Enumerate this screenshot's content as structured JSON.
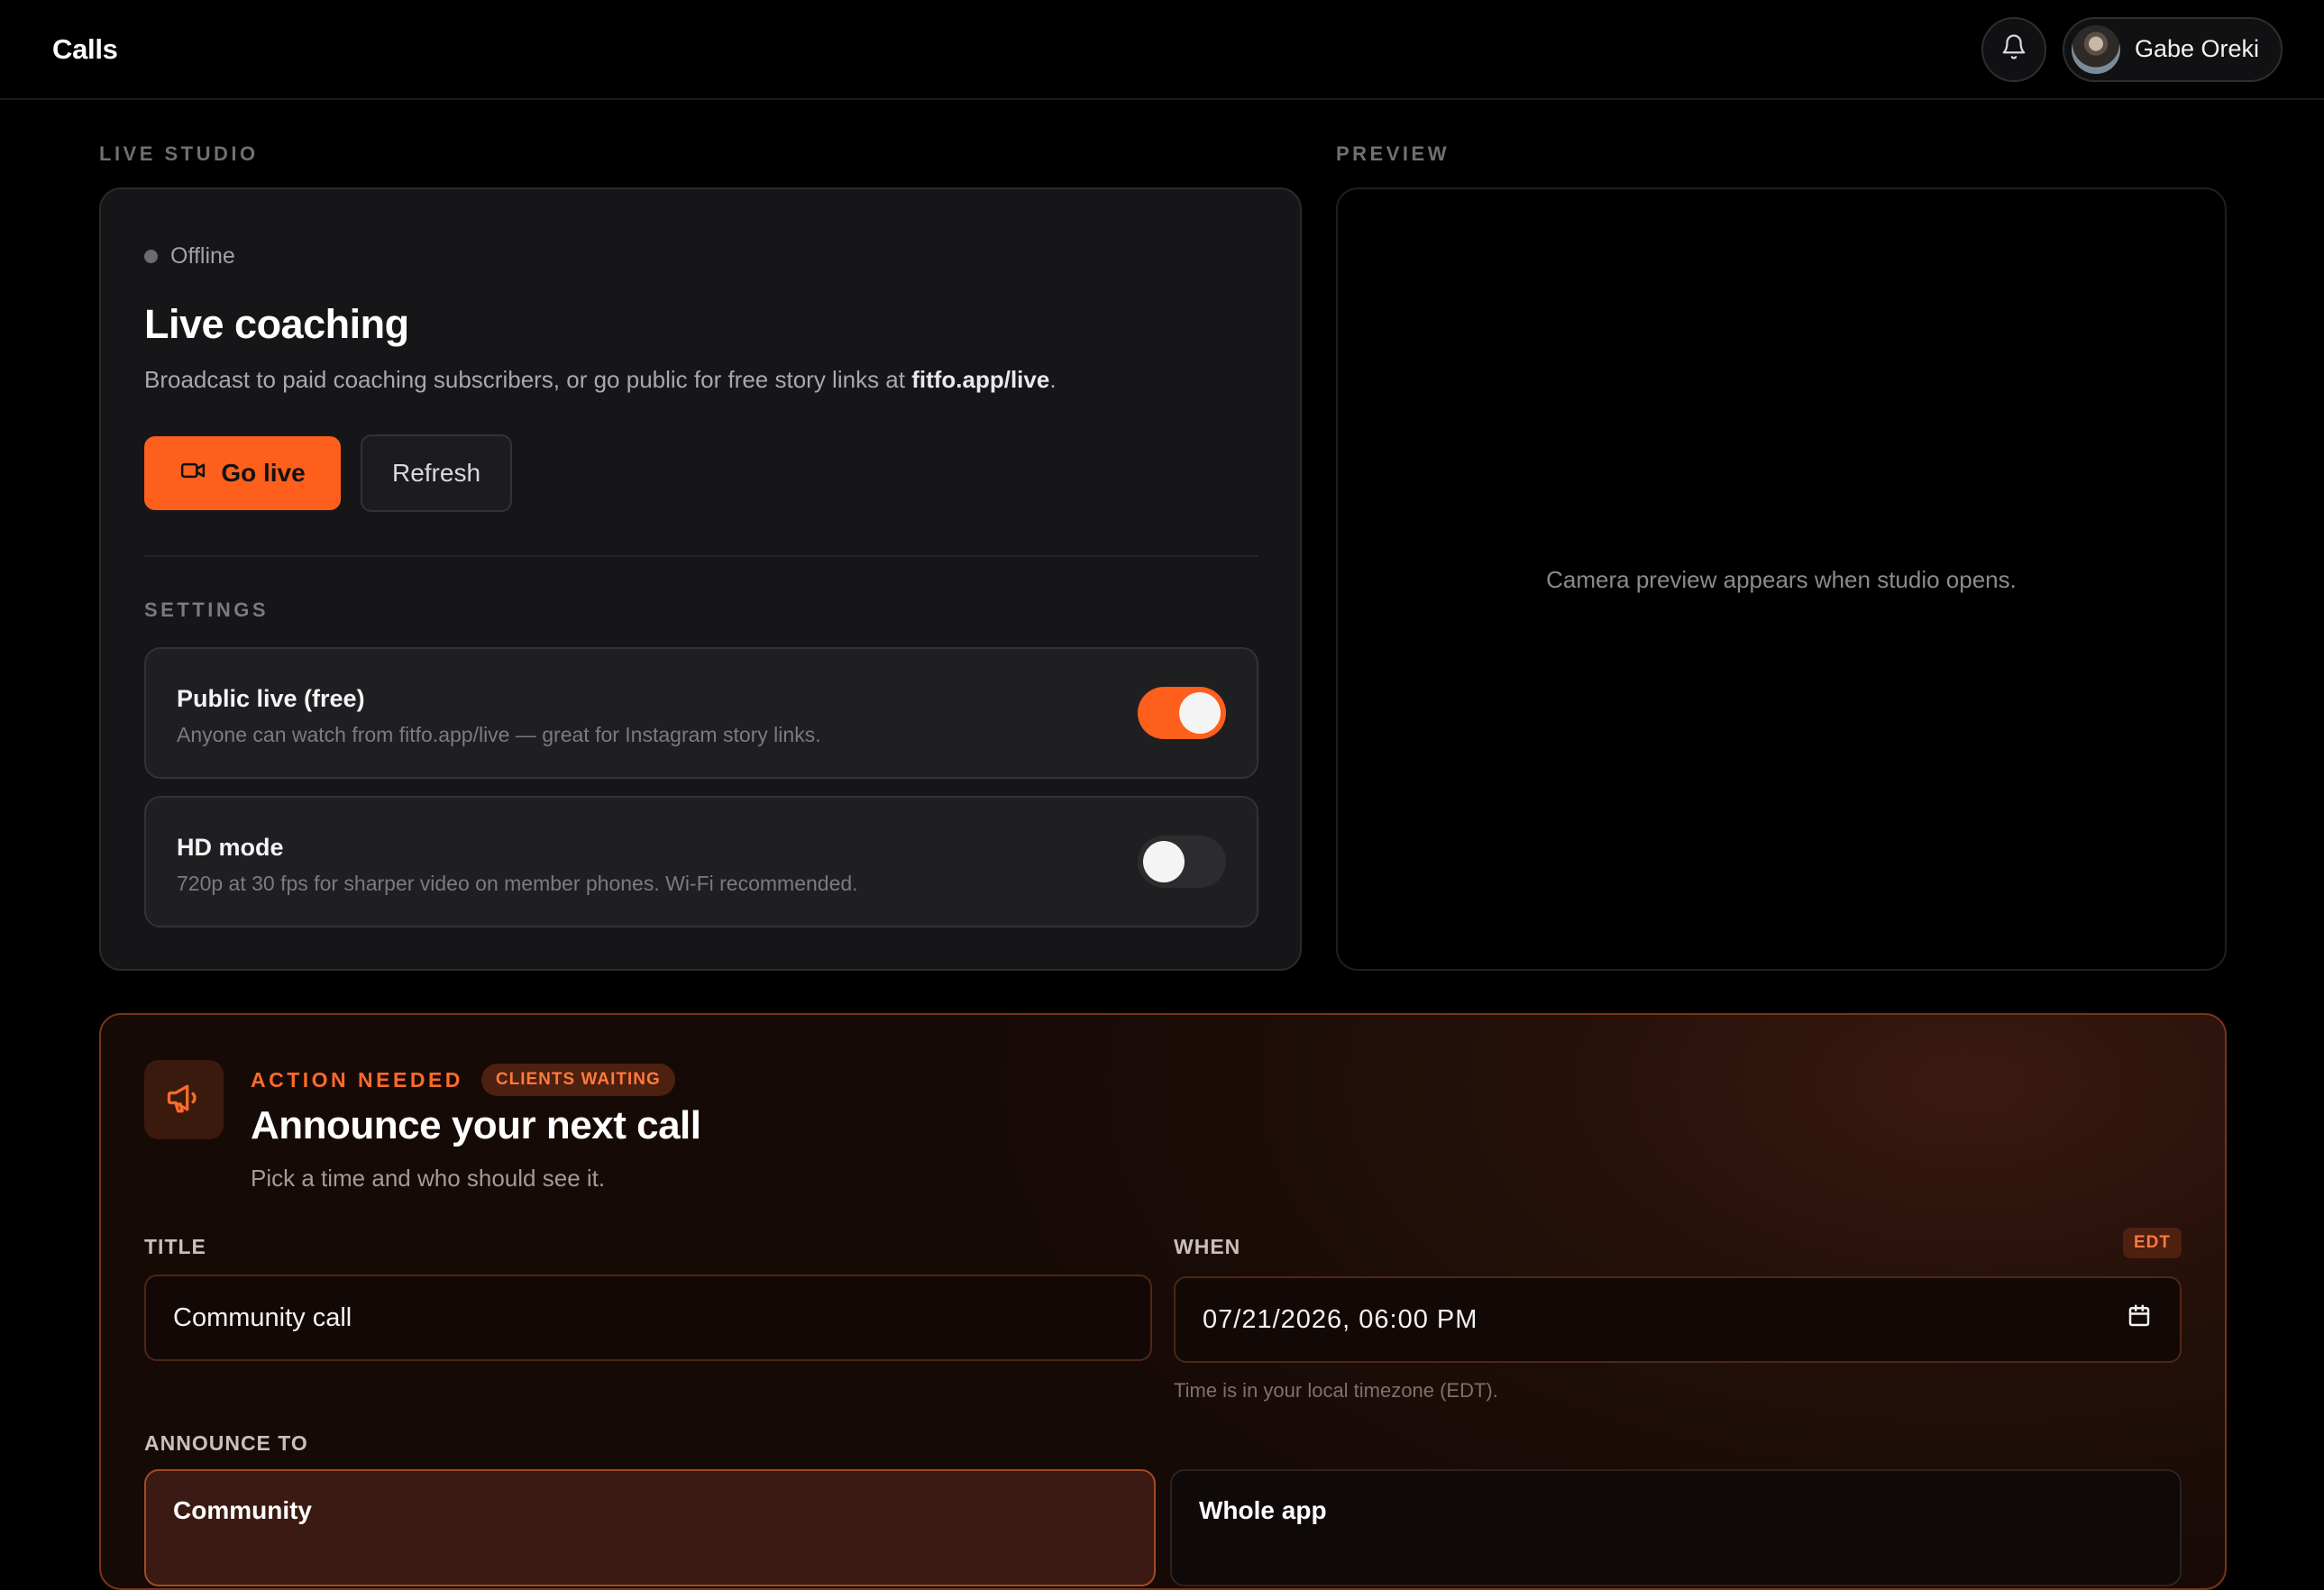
{
  "topbar": {
    "title": "Calls",
    "user_name": "Gabe Oreki"
  },
  "live_studio": {
    "section_label": "LIVE STUDIO",
    "status": "Offline",
    "title": "Live coaching",
    "description_prefix": "Broadcast to paid coaching subscribers, or go public for free story links at ",
    "description_link": "fitfo.app/live",
    "description_suffix": ".",
    "go_live_label": "Go live",
    "refresh_label": "Refresh",
    "settings_label": "SETTINGS",
    "settings": [
      {
        "title": "Public live (free)",
        "description": "Anyone can watch from fitfo.app/live — great for Instagram story links.",
        "enabled": true
      },
      {
        "title": "HD mode",
        "description": "720p at 30 fps for sharper video on member phones. Wi-Fi recommended.",
        "enabled": false
      }
    ]
  },
  "preview": {
    "section_label": "PREVIEW",
    "placeholder": "Camera preview appears when studio opens."
  },
  "announce": {
    "kicker": "ACTION NEEDED",
    "badge": "CLIENTS WAITING",
    "title": "Announce your next call",
    "subtitle": "Pick a time and who should see it.",
    "title_label": "TITLE",
    "title_value": "Community call",
    "when_label": "WHEN",
    "timezone_badge": "EDT",
    "when_value": "07/21/2026, 06:00 PM",
    "timezone_help": "Time is in your local timezone (EDT).",
    "announce_to_label": "ANNOUNCE TO",
    "options": [
      {
        "label": "Community",
        "selected": true
      },
      {
        "label": "Whole app",
        "selected": false
      }
    ]
  },
  "colors": {
    "accent": "#ff5f1c",
    "background": "#000000",
    "card": "#161618"
  }
}
